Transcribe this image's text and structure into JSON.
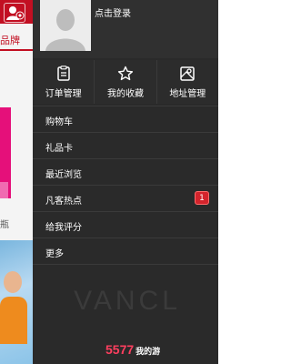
{
  "background_page": {
    "tab_label": "品牌",
    "caption": "瓶",
    "header_color": "#c20f22"
  },
  "drawer": {
    "login_text": "点击登录",
    "quick_actions": [
      {
        "icon": "order-list-icon",
        "label": "订单管理"
      },
      {
        "icon": "star-icon",
        "label": "我的收藏"
      },
      {
        "icon": "map-icon",
        "label": "地址管理"
      }
    ],
    "menu": [
      {
        "label": "购物车"
      },
      {
        "label": "礼品卡"
      },
      {
        "label": "最近浏览"
      },
      {
        "label": "凡客热点",
        "badge": "1"
      },
      {
        "label": "给我评分"
      },
      {
        "label": "更多"
      }
    ],
    "brand": "VANCL",
    "watermark": {
      "main": "5577",
      "sub": "我的游"
    }
  },
  "colors": {
    "accent": "#c20f22",
    "drawer_bg": "#2a2a2a",
    "badge": "#d3242c"
  }
}
